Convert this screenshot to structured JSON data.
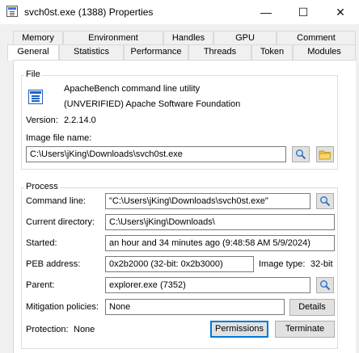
{
  "window": {
    "title": "svch0st.exe (1388) Properties",
    "app_icon": "process-properties-icon",
    "controls": {
      "minimize": "—",
      "maximize": "☐",
      "close": "✕"
    }
  },
  "tabs_row_top": [
    "Memory",
    "Environment",
    "Handles",
    "GPU",
    "Comment"
  ],
  "tabs_row_bottom": [
    "General",
    "Statistics",
    "Performance",
    "Threads",
    "Token",
    "Modules"
  ],
  "active_tab": "General",
  "file": {
    "group_label": "File",
    "icon": "executable-icon",
    "description": "ApacheBench command line utility",
    "company": "(UNVERIFIED) Apache Software Foundation",
    "version_label": "Version:",
    "version_value": "2.2.14.0",
    "image_label": "Image file name:",
    "image_path": "C:\\Users\\jKing\\Downloads\\svch0st.exe"
  },
  "process": {
    "group_label": "Process",
    "command_line_label": "Command line:",
    "command_line": "\"C:\\Users\\jKing\\Downloads\\svch0st.exe\"",
    "current_dir_label": "Current directory:",
    "current_dir": "C:\\Users\\jKing\\Downloads\\",
    "started_label": "Started:",
    "started": "an hour and 34 minutes ago (9:48:58 AM 5/9/2024)",
    "peb_label": "PEB address:",
    "peb": "0x2b2000 (32-bit: 0x2b3000)",
    "image_type_label": "Image type:",
    "image_type": "32-bit",
    "parent_label": "Parent:",
    "parent": "explorer.exe (7352)",
    "mitigation_label": "Mitigation policies:",
    "mitigation": "None",
    "details_button": "Details",
    "protection_label": "Protection:",
    "protection": "None",
    "permissions_button": "Permissions",
    "terminate_button": "Terminate"
  }
}
